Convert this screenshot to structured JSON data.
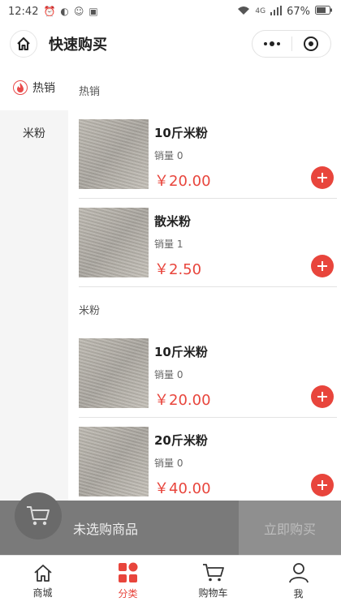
{
  "status_bar": {
    "time": "12:42",
    "signal": "4G",
    "battery": "67%"
  },
  "header": {
    "title": "快速购买"
  },
  "sidebar": {
    "items": [
      {
        "label": "热销"
      },
      {
        "label": "米粉"
      }
    ]
  },
  "sections": [
    {
      "title": "热销",
      "products": [
        {
          "name": "10斤米粉",
          "sales": "销量 0",
          "price": "￥20.00"
        },
        {
          "name": "散米粉",
          "sales": "销量 1",
          "price": "￥2.50"
        }
      ]
    },
    {
      "title": "米粉",
      "products": [
        {
          "name": "10斤米粉",
          "sales": "销量 0",
          "price": "￥20.00"
        },
        {
          "name": "20斤米粉",
          "sales": "销量 0",
          "price": "￥40.00"
        }
      ]
    }
  ],
  "cart": {
    "empty_label": "未选购商品",
    "buy_label": "立即购买"
  },
  "tabbar": {
    "items": [
      {
        "label": "商城"
      },
      {
        "label": "分类"
      },
      {
        "label": "购物车"
      },
      {
        "label": "我"
      }
    ]
  },
  "colors": {
    "accent": "#e8453c",
    "cart_bar": "#7a7a7a"
  }
}
